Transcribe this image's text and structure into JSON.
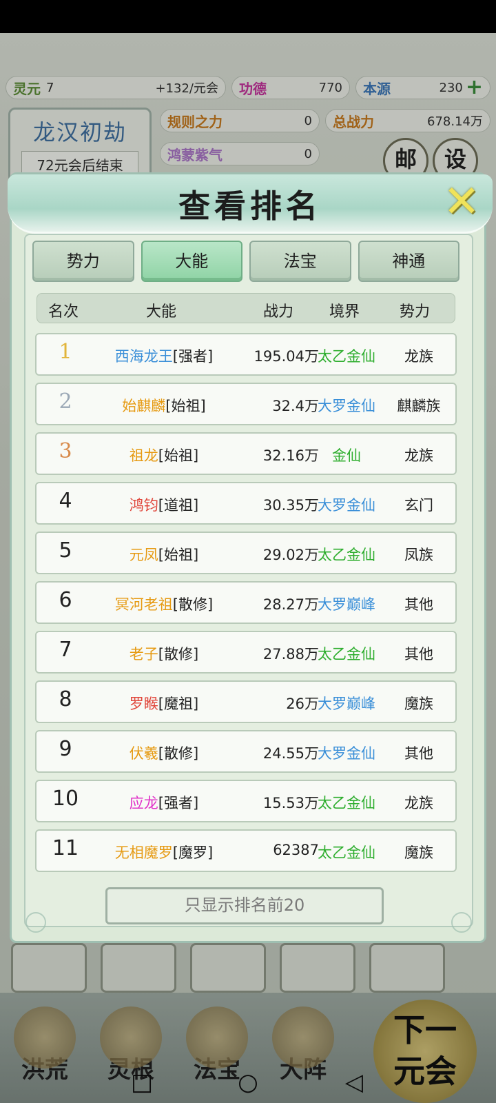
{
  "resources": {
    "lingyuan": {
      "label": "灵元",
      "value": "7",
      "rate": "+132/元会"
    },
    "gongde": {
      "label": "功德",
      "value": "770"
    },
    "benyuan": {
      "label": "本源",
      "value": "230"
    },
    "guize": {
      "label": "规则之力",
      "value": "0"
    },
    "zhanli": {
      "label": "总战力",
      "value": "678.14万"
    },
    "hongmeng": {
      "label": "鸿蒙紫气",
      "value": "0"
    }
  },
  "era": {
    "title": "龙汉初劫",
    "subtitle": "72元会后结束"
  },
  "top_buttons": {
    "mail": "邮",
    "settings": "设"
  },
  "bottom_nav": [
    {
      "label": "洪荒",
      "icon": "volcano-icon"
    },
    {
      "label": "灵根",
      "icon": "lotus-icon"
    },
    {
      "label": "法宝",
      "icon": "treasure-icon"
    },
    {
      "label": "大阵",
      "icon": "taiji-icon"
    }
  ],
  "next_era": {
    "line1": "下一",
    "line2": "元会"
  },
  "modal": {
    "title": "查看排名",
    "close_icon": "close-icon",
    "tabs": [
      {
        "label": "势力",
        "active": false
      },
      {
        "label": "大能",
        "active": true
      },
      {
        "label": "法宝",
        "active": false
      },
      {
        "label": "神通",
        "active": false
      }
    ],
    "columns": {
      "rank": "名次",
      "name": "大能",
      "power": "战力",
      "realm": "境界",
      "faction": "势力"
    },
    "rows": [
      {
        "rank": "1",
        "name": "西海龙王",
        "title": "[强者]",
        "power": "195.04万",
        "realm": "太乙金仙",
        "faction": "龙族",
        "name_color": "#3a8fd8",
        "realm_color": "#2fae2f"
      },
      {
        "rank": "2",
        "name": "始麒麟",
        "title": "[始祖]",
        "power": "32.4万",
        "realm": "大罗金仙",
        "faction": "麒麟族",
        "name_color": "#e69a12",
        "realm_color": "#3a8fd8"
      },
      {
        "rank": "3",
        "name": "祖龙",
        "title": "[始祖]",
        "power": "32.16万",
        "realm": "金仙",
        "faction": "龙族",
        "name_color": "#e69a12",
        "realm_color": "#2fae2f"
      },
      {
        "rank": "4",
        "name": "鸿钧",
        "title": "[道祖]",
        "power": "30.35万",
        "realm": "大罗金仙",
        "faction": "玄门",
        "name_color": "#e0453a",
        "realm_color": "#3a8fd8"
      },
      {
        "rank": "5",
        "name": "元凤",
        "title": "[始祖]",
        "power": "29.02万",
        "realm": "太乙金仙",
        "faction": "凤族",
        "name_color": "#e69a12",
        "realm_color": "#2fae2f"
      },
      {
        "rank": "6",
        "name": "冥河老祖",
        "title": "[散修]",
        "power": "28.27万",
        "realm": "大罗巅峰",
        "faction": "其他",
        "name_color": "#e69a12",
        "realm_color": "#3a8fd8"
      },
      {
        "rank": "7",
        "name": "老子",
        "title": "[散修]",
        "power": "27.88万",
        "realm": "太乙金仙",
        "faction": "其他",
        "name_color": "#e69a12",
        "realm_color": "#2fae2f"
      },
      {
        "rank": "8",
        "name": "罗睺",
        "title": "[魔祖]",
        "power": "26万",
        "realm": "大罗巅峰",
        "faction": "魔族",
        "name_color": "#e0453a",
        "realm_color": "#3a8fd8"
      },
      {
        "rank": "9",
        "name": "伏羲",
        "title": "[散修]",
        "power": "24.55万",
        "realm": "大罗金仙",
        "faction": "其他",
        "name_color": "#e69a12",
        "realm_color": "#3a8fd8"
      },
      {
        "rank": "10",
        "name": "应龙",
        "title": "[强者]",
        "power": "15.53万",
        "realm": "太乙金仙",
        "faction": "龙族",
        "name_color": "#e030c8",
        "realm_color": "#2fae2f"
      },
      {
        "rank": "11",
        "name": "无相魔罗",
        "title": "[魔罗]",
        "power": "62387",
        "realm": "太乙金仙",
        "faction": "魔族",
        "name_color": "#e69a12",
        "realm_color": "#2fae2f"
      }
    ],
    "filter_button": "只显示排名前20"
  },
  "system_nav": {
    "home_icon": "home-icon",
    "recent_icon": "recent-apps-icon",
    "back_icon": "back-icon"
  }
}
